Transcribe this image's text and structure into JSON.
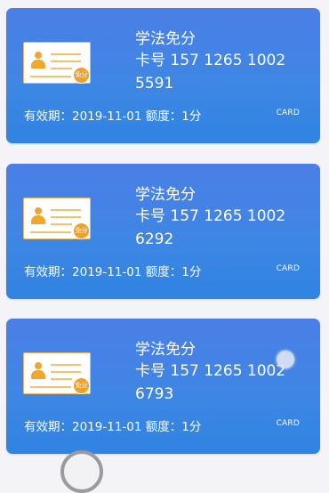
{
  "cards": [
    {
      "title": "学法免分",
      "card_no": "卡号 157 1265 1002 5591",
      "validity": "有效期：2019-11-01 额度：1分",
      "tag": "CARD",
      "badge": "免分"
    },
    {
      "title": "学法免分",
      "card_no": "卡号 157 1265 1002 6292",
      "validity": "有效期：2019-11-01 额度：1分",
      "tag": "CARD",
      "badge": "免分"
    },
    {
      "title": "学法免分",
      "card_no": "卡号 157 1265 1002 6793",
      "validity": "有效期：2019-11-01 额度：1分",
      "tag": "CARD",
      "badge": "免分"
    }
  ],
  "colors": {
    "card_top": "#4b7fe6",
    "card_bottom": "#2f84e2",
    "icon_accent": "#f1a72c",
    "background": "#f4f3f8"
  },
  "icons": {
    "card_icon": "id-card-icon"
  }
}
